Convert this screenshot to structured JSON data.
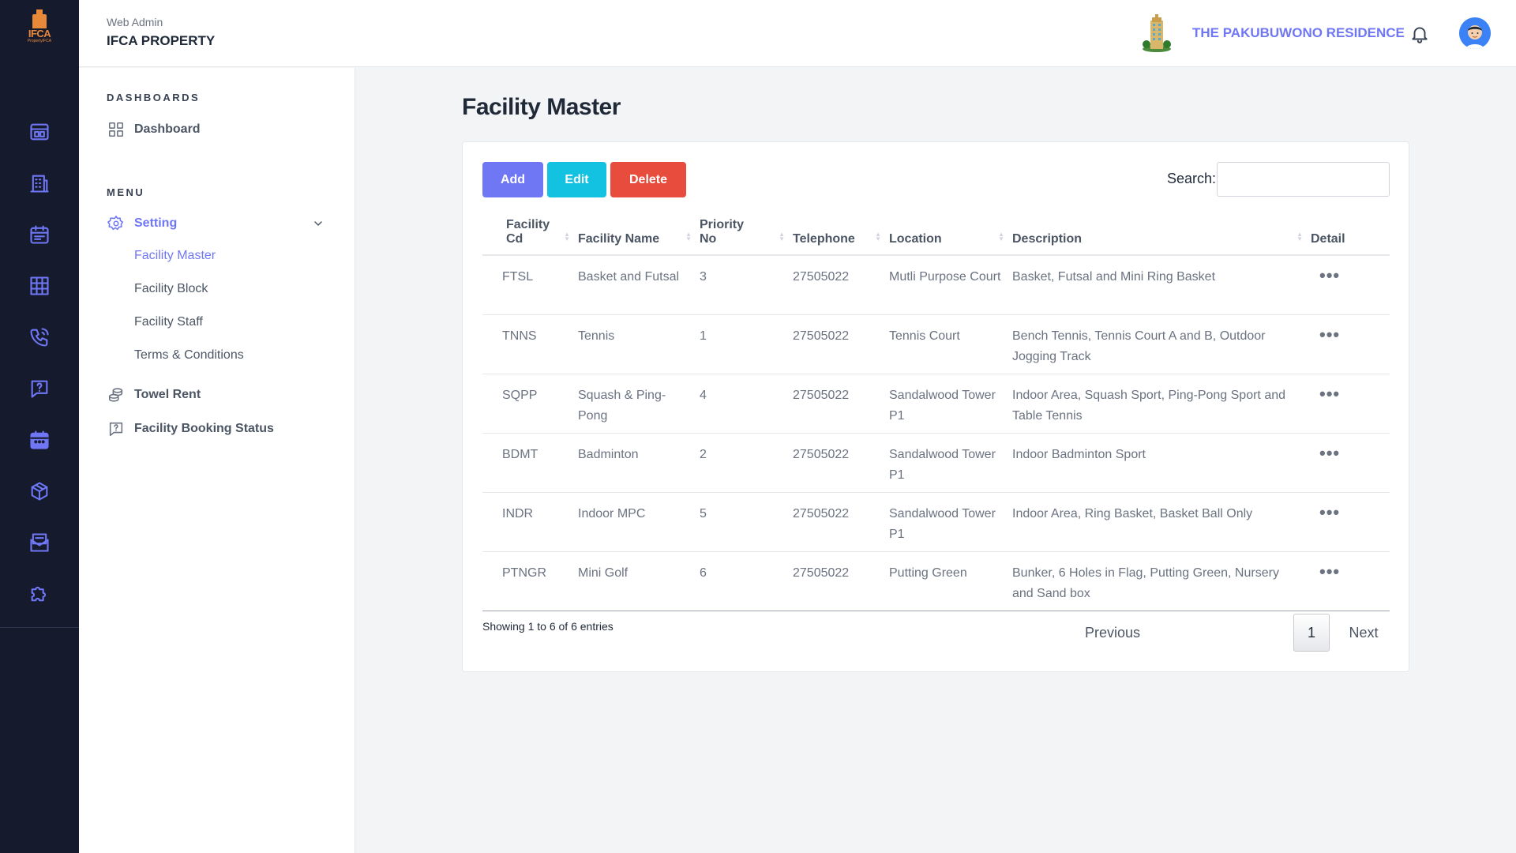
{
  "rail": {
    "logo_text": "IFCA",
    "logo_sub": "PropertyIFCA",
    "icons": [
      "dashboard-icon",
      "building-icon",
      "calendar-icon",
      "grid-icon",
      "phone-icon",
      "help-icon",
      "calendar-filled-icon",
      "box-icon",
      "mail-icon",
      "puzzle-icon"
    ]
  },
  "header": {
    "subtitle": "Web Admin",
    "title": "IFCA PROPERTY",
    "residence": "THE PAKUBUWONO RESIDENCE"
  },
  "sidebar": {
    "dashboards_heading": "DASHBOARDS",
    "dashboard_label": "Dashboard",
    "menu_heading": "MENU",
    "setting_label": "Setting",
    "sub_items": [
      "Facility Master",
      "Facility Block",
      "Facility Staff",
      "Terms & Conditions"
    ],
    "towel_rent_label": "Towel Rent",
    "booking_status_label": "Facility Booking Status"
  },
  "main": {
    "title": "Facility Master",
    "add_label": "Add",
    "edit_label": "Edit",
    "delete_label": "Delete",
    "search_label": "Search:",
    "search_value": "",
    "columns": [
      "Facility Cd",
      "Facility Name",
      "Priority No",
      "Telephone",
      "Location",
      "Description",
      "Detail"
    ],
    "rows": [
      {
        "cd": "FTSL",
        "name": "Basket and Futsal",
        "priority": "3",
        "phone": "27505022",
        "location": "Mutli Purpose Court",
        "description": "Basket, Futsal and Mini Ring Basket"
      },
      {
        "cd": "TNNS",
        "name": "Tennis",
        "priority": "1",
        "phone": "27505022",
        "location": "Tennis Court",
        "description": "Bench Tennis, Tennis Court A and B, Outdoor Jogging Track"
      },
      {
        "cd": "SQPP",
        "name": "Squash & Ping-Pong",
        "priority": "4",
        "phone": "27505022",
        "location": "Sandalwood Tower P1",
        "description": "Indoor Area, Squash Sport, Ping-Pong Sport and Table Tennis"
      },
      {
        "cd": "BDMT",
        "name": "Badminton",
        "priority": "2",
        "phone": "27505022",
        "location": "Sandalwood Tower P1",
        "description": "Indoor Badminton Sport"
      },
      {
        "cd": "INDR",
        "name": "Indoor MPC",
        "priority": "5",
        "phone": "27505022",
        "location": "Sandalwood Tower P1",
        "description": "Indoor Area, Ring Basket, Basket Ball Only"
      },
      {
        "cd": "PTNGR",
        "name": "Mini Golf",
        "priority": "6",
        "phone": "27505022",
        "location": "Putting Green",
        "description": "Bunker, 6 Holes in Flag, Putting Green, Nursery and Sand box"
      }
    ],
    "detail_glyph": "•••",
    "showing": "Showing 1 to 6 of 6 entries",
    "previous_label": "Previous",
    "page_number": "1",
    "next_label": "Next"
  },
  "colors": {
    "accent": "#6f77f5",
    "rail_bg": "#151a2d",
    "edit": "#12c2e0",
    "delete": "#e84c3d"
  }
}
